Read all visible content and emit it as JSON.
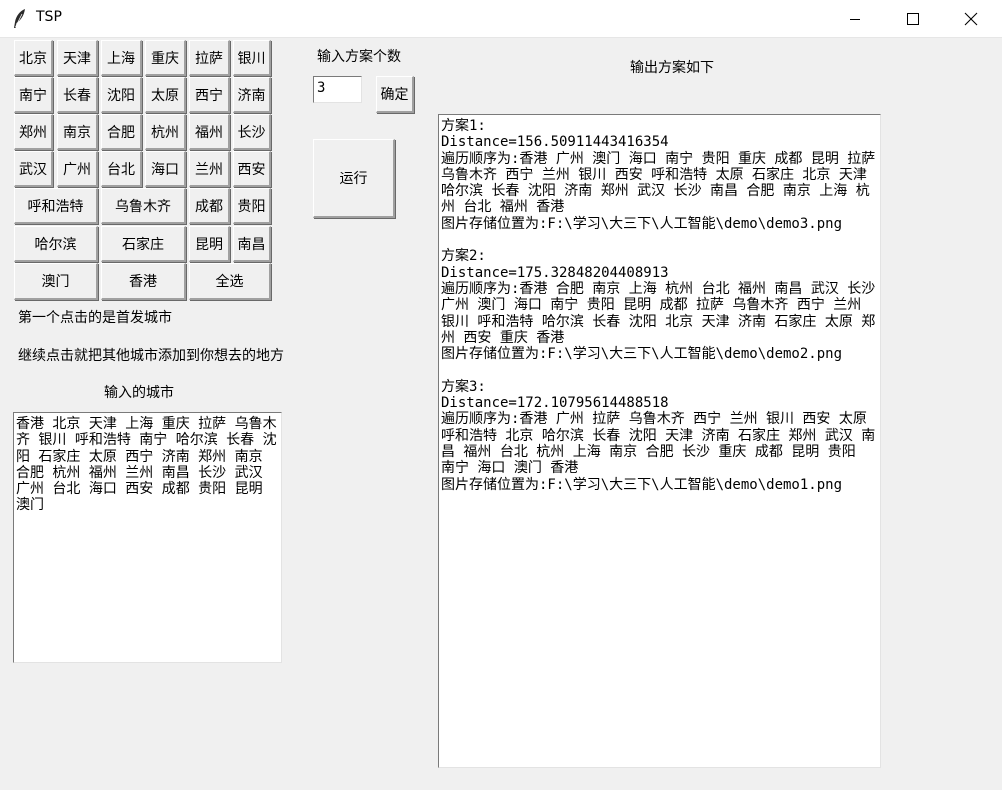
{
  "window": {
    "title": "TSP"
  },
  "cities": {
    "row1": [
      "北京",
      "天津",
      "上海",
      "重庆",
      "拉萨",
      "银川"
    ],
    "row2": [
      "南宁",
      "长春",
      "沈阳",
      "太原",
      "西宁",
      "济南"
    ],
    "row3": [
      "郑州",
      "南京",
      "合肥",
      "杭州",
      "福州",
      "长沙"
    ],
    "row4": [
      "武汉",
      "广州",
      "台北",
      "海口",
      "兰州",
      "西安"
    ],
    "row5": [
      "呼和浩特",
      "乌鲁木齐",
      "成都",
      "贵阳"
    ],
    "row6": [
      "哈尔滨",
      "石家庄",
      "昆明",
      "南昌"
    ],
    "row7": [
      "澳门",
      "香港"
    ],
    "select_all": "全选"
  },
  "hints": {
    "first_click": "第一个点击的是首发城市",
    "continue_click": "继续点击就把其他城市添加到你想去的地方",
    "input_cities_label": "输入的城市"
  },
  "input_cities_text": "香港 北京 天津 上海 重庆 拉萨 乌鲁木齐 银川 呼和浩特 南宁 哈尔滨 长春 沈阳 石家庄 太原 西宁 济南 郑州 南京 合肥 杭州 福州 兰州 南昌 长沙 武汉 广州 台北 海口 西安 成都 贵阳 昆明 澳门",
  "plan_count": {
    "label": "输入方案个数",
    "value": "3",
    "confirm": "确定"
  },
  "run_button": "运行",
  "output": {
    "label": "输出方案如下",
    "text": "方案1:\nDistance=156.50911443416354\n遍历顺序为:香港 广州 澳门 海口 南宁 贵阳 重庆 成都 昆明 拉萨 乌鲁木齐 西宁 兰州 银川 西安 呼和浩特 太原 石家庄 北京 天津 哈尔滨 长春 沈阳 济南 郑州 武汉 长沙 南昌 合肥 南京 上海 杭州 台北 福州 香港\n图片存储位置为:F:\\学习\\大三下\\人工智能\\demo\\demo3.png\n\n方案2:\nDistance=175.32848204408913\n遍历顺序为:香港 合肥 南京 上海 杭州 台北 福州 南昌 武汉 长沙 广州 澳门 海口 南宁 贵阳 昆明 成都 拉萨 乌鲁木齐 西宁 兰州 银川 呼和浩特 哈尔滨 长春 沈阳 北京 天津 济南 石家庄 太原 郑州 西安 重庆 香港\n图片存储位置为:F:\\学习\\大三下\\人工智能\\demo\\demo2.png\n\n方案3:\nDistance=172.10795614488518\n遍历顺序为:香港 广州 拉萨 乌鲁木齐 西宁 兰州 银川 西安 太原 呼和浩特 北京 哈尔滨 长春 沈阳 天津 济南 石家庄 郑州 武汉 南昌 福州 台北 杭州 上海 南京 合肥 长沙 重庆 成都 昆明 贵阳 南宁 海口 澳门 香港\n图片存储位置为:F:\\学习\\大三下\\人工智能\\demo\\demo1.png"
  }
}
